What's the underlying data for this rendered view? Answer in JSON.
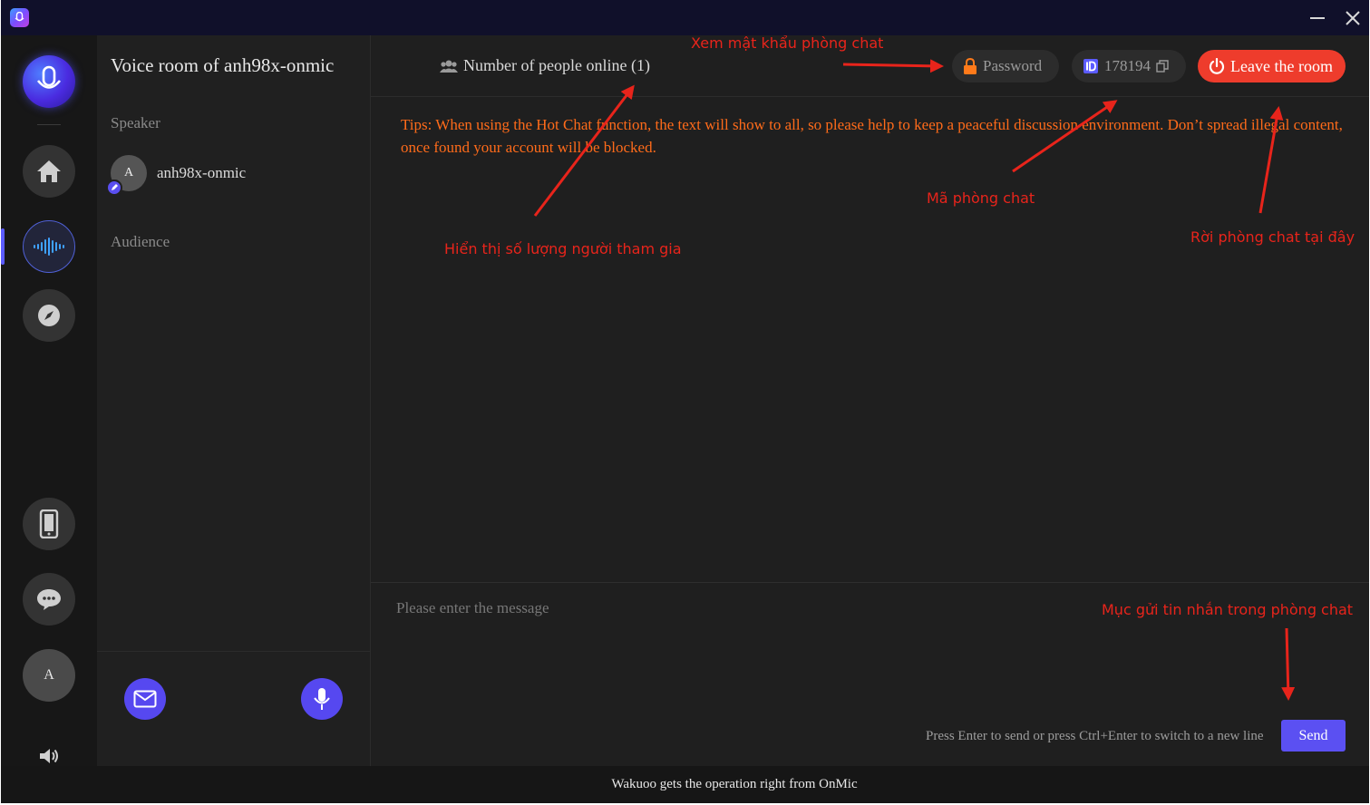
{
  "footer": {
    "text": "Wakuoo gets the operation right from OnMic"
  },
  "room": {
    "title": "Voice room of anh98x-onmic",
    "online_label": "Number of people online (1)",
    "password_label": "Password",
    "room_id": "178194",
    "leave_label": "Leave the room"
  },
  "sidebar": {
    "speaker_heading": "Speaker",
    "speaker_name": "anh98x-onmic",
    "speaker_initial": "A",
    "audience_heading": "Audience",
    "user_initial": "A"
  },
  "chat": {
    "tips": "Tips: When using the Hot Chat function, the text will show to all, so please help to keep a peaceful discussion environment. Don’t spread illegal content, once found your account will be blocked.",
    "placeholder": "Please enter the message",
    "hint": "Press Enter to send or press Ctrl+Enter to switch to a new line",
    "send_label": "Send"
  },
  "annotations": {
    "password": "Xem mật khẩu phòng chat",
    "online": "Hiển thị số lượng người tham gia",
    "room_id": "Mã phòng chat",
    "leave": "Rời phòng chat tại đây",
    "send": "Mục gửi tin nhắn trong phòng chat"
  },
  "colors": {
    "accent": "#5b50f2",
    "leave": "#ee3c2c",
    "tips": "#ff6b1a",
    "annotation": "#e8241b"
  }
}
